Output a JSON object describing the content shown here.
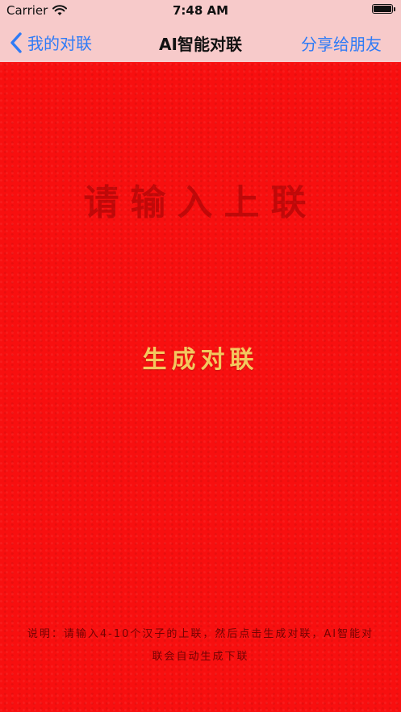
{
  "status_bar": {
    "carrier": "Carrier",
    "time": "7:48 AM"
  },
  "nav": {
    "back_label": "我的对联",
    "title": "AI智能对联",
    "share_label": "分享给朋友"
  },
  "main": {
    "input_placeholder": "请输入上联",
    "generate_label": "生成对联",
    "note": "说明：请输入4-10个汉子的上联，然后点击生成对联，AI智能对联会自动生成下联"
  },
  "colors": {
    "background": "#f60d0d",
    "navbar": "#f7caca",
    "accent": "#2f7bf6",
    "gold": "#f4c75e"
  },
  "icons": {
    "back": "chevron-left-icon",
    "wifi": "wifi-icon",
    "battery": "battery-icon"
  }
}
